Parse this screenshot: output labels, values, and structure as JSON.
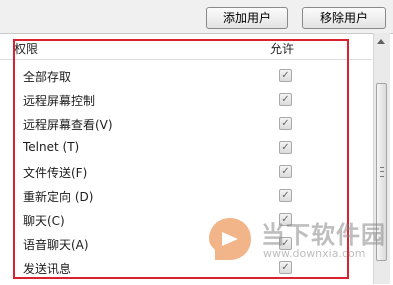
{
  "toolbar": {
    "add_label": "添加用户",
    "remove_label": "移除用户"
  },
  "table": {
    "header_permission": "权限",
    "header_allow": "允许",
    "rows": [
      {
        "label": "全部存取",
        "checked": true
      },
      {
        "label": "远程屏幕控制",
        "checked": true
      },
      {
        "label": "远程屏幕查看(V)",
        "checked": true
      },
      {
        "label": "Telnet (T)",
        "checked": true
      },
      {
        "label": "文件传送(F)",
        "checked": true
      },
      {
        "label": "重新定向 (D)",
        "checked": true
      },
      {
        "label": "聊天(C)",
        "checked": true
      },
      {
        "label": "语音聊天(A)",
        "checked": true
      },
      {
        "label": "发送讯息",
        "checked": true
      }
    ]
  },
  "watermark": {
    "title": "当下软件园",
    "url": "www.downxia.com"
  },
  "colors": {
    "highlight": "#d8232f",
    "accent_logo": "#e87a2a"
  }
}
